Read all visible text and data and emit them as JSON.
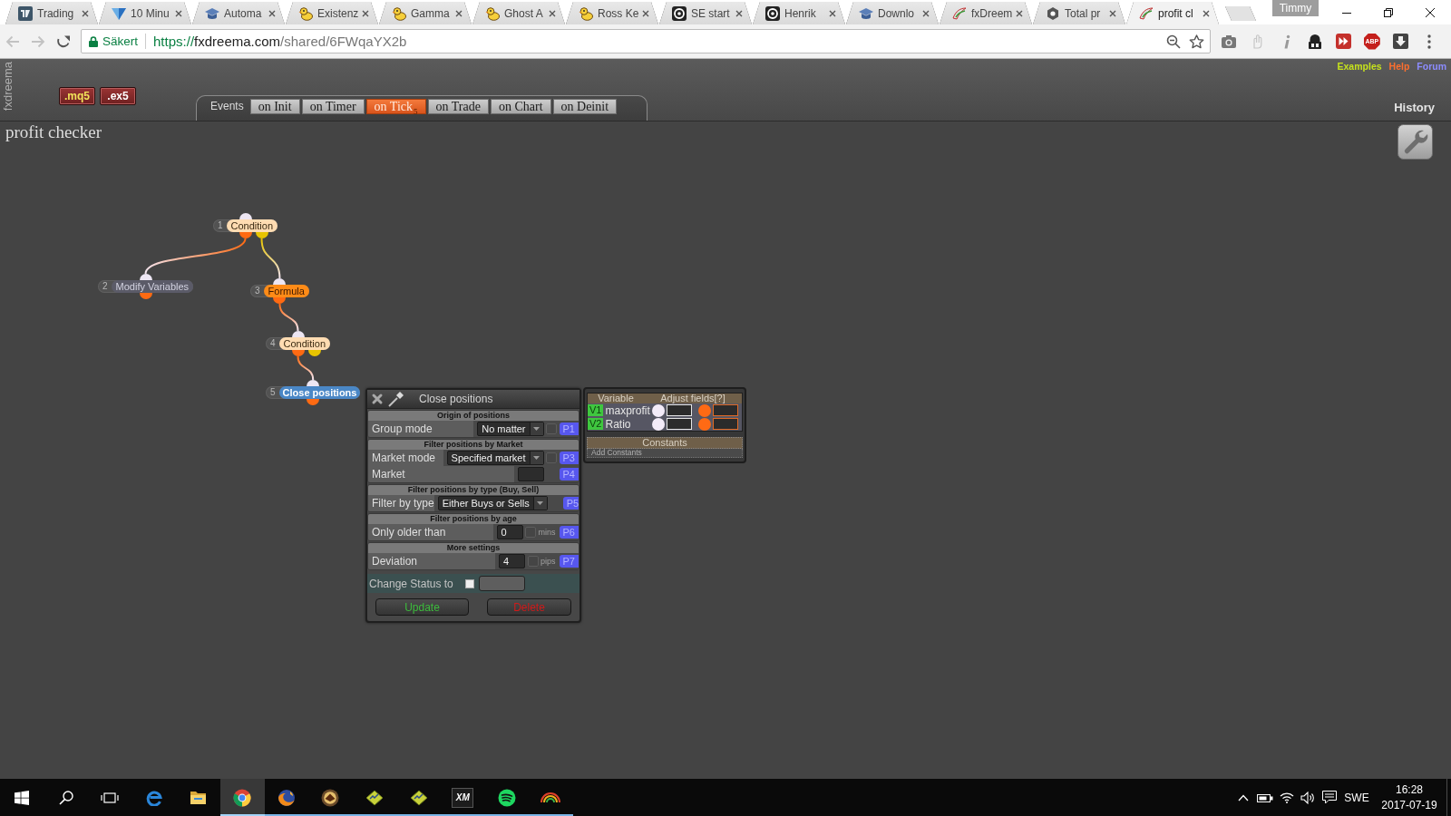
{
  "browser": {
    "tabs": [
      {
        "kind": "tile",
        "title": "Trading",
        "selected": false
      },
      {
        "kind": "triangle",
        "title": "10 Minu",
        "selected": false
      },
      {
        "kind": "cap",
        "title": "Automa",
        "selected": false
      },
      {
        "kind": "duck",
        "title": "Existenz",
        "selected": false
      },
      {
        "kind": "duck",
        "title": "Gamma",
        "selected": false
      },
      {
        "kind": "duck",
        "title": "Ghost A",
        "selected": false
      },
      {
        "kind": "duck",
        "title": "Ross Ke",
        "selected": false
      },
      {
        "kind": "disc",
        "title": "SE start",
        "selected": false
      },
      {
        "kind": "disc",
        "title": "Henrik",
        "selected": false
      },
      {
        "kind": "cap",
        "title": "Downlo",
        "selected": false
      },
      {
        "kind": "swoosh",
        "title": "fxDreem",
        "selected": false
      },
      {
        "kind": "hexagon",
        "title": "Total pr",
        "selected": false
      },
      {
        "kind": "swoosh",
        "title": "profit cl",
        "selected": true
      }
    ],
    "profile": "Timmy",
    "security_label": "Säkert",
    "url": "https://fxdreema.com/shared/6FWqaYX2b",
    "extensions": [
      {
        "kind": "camera"
      },
      {
        "kind": "pointer"
      },
      {
        "kind": "info"
      },
      {
        "kind": "figure"
      },
      {
        "kind": "forward"
      },
      {
        "kind": "octagon",
        "label": "ABP"
      },
      {
        "kind": "download"
      }
    ]
  },
  "app": {
    "side_label": "fxdreema",
    "export_buttons": [
      {
        "label": ".mq5",
        "kind": "source"
      },
      {
        "label": ".ex5",
        "kind": "compiled"
      }
    ],
    "events": {
      "label": "Events",
      "tabs": [
        {
          "label": "on Init",
          "selected": false
        },
        {
          "label": "on Timer",
          "selected": false
        },
        {
          "label": "on Tick",
          "selected": true,
          "count": "5"
        },
        {
          "label": "on Trade",
          "selected": false
        },
        {
          "label": "on Chart",
          "selected": false
        },
        {
          "label": "on Deinit",
          "selected": false
        }
      ]
    },
    "links": [
      {
        "label": "Examples",
        "color": "#c6e21c"
      },
      {
        "label": "Help",
        "color": "#ff6f2e"
      },
      {
        "label": "Forum",
        "color": "#8c8cff"
      }
    ],
    "history": "History",
    "project_title": "profit checker",
    "diagram": {
      "blocks": [
        {
          "number": "1",
          "label": "Condition",
          "kind": "condition",
          "selected": false,
          "children": [
            {
              "from_secondary": false,
              "number": "2",
              "label": "Modify Variables",
              "kind": "variables",
              "selected": false
            },
            {
              "from_secondary": true,
              "number": "3",
              "label": "Formula",
              "kind": "formula",
              "selected": false,
              "children": [
                {
                  "from_secondary": false,
                  "number": "4",
                  "label": "Condition",
                  "kind": "condition",
                  "selected": false,
                  "children": [
                    {
                      "from_secondary": false,
                      "number": "5",
                      "label": "Close positions",
                      "kind": "trade",
                      "selected": true
                    }
                  ]
                }
              ]
            }
          ]
        }
      ]
    },
    "block_panel": {
      "title": "Close positions",
      "sections": [
        {
          "heading": "Origin of positions",
          "rows": [
            {
              "kind": "select",
              "label": "Group mode",
              "value": "No matter",
              "checked": false,
              "param": "P1"
            }
          ]
        },
        {
          "heading": "Filter positions by Market",
          "rows": [
            {
              "kind": "select",
              "label": "Market mode",
              "value": "Specified market",
              "checked": false,
              "param": "P3"
            },
            {
              "kind": "input",
              "label": "Market",
              "param": "P4"
            }
          ]
        },
        {
          "heading": "Filter positions by type (Buy, Sell)",
          "rows": [
            {
              "kind": "select",
              "label": "Filter by type",
              "value": "Either Buys or Sells",
              "param": "P5"
            }
          ]
        },
        {
          "heading": "Filter positions by age",
          "rows": [
            {
              "kind": "input",
              "label": "Only older than",
              "value": "0",
              "checked": false,
              "unit": "mins",
              "param": "P6"
            }
          ]
        },
        {
          "heading": "More settings",
          "rows": [
            {
              "kind": "input",
              "label": "Deviation",
              "value": "4",
              "checked": false,
              "unit": "pips",
              "param": "P7"
            }
          ]
        }
      ],
      "status": {
        "label": "Change Status to",
        "checked": false
      },
      "buttons": [
        {
          "kind": "update",
          "label": "Update"
        },
        {
          "kind": "delete",
          "label": "Delete"
        }
      ]
    },
    "variables_panel": {
      "columns": [
        "Variable",
        "Adjust fields[?]"
      ],
      "variables": [
        {
          "id": "V1",
          "name": "maxprofit"
        },
        {
          "id": "V2",
          "name": "Ratio"
        }
      ],
      "constants_heading": "Constants",
      "add_label": "Add Constants"
    }
  },
  "taskbar": {
    "apps": [
      {
        "kind": "letter",
        "running": false,
        "selected": false
      },
      {
        "kind": "folder",
        "running": false,
        "selected": false
      },
      {
        "kind": "ring",
        "running": true,
        "selected": true
      },
      {
        "kind": "fox",
        "running": true,
        "selected": false
      },
      {
        "kind": "emblem",
        "running": true,
        "selected": false
      },
      {
        "kind": "diamond",
        "running": true,
        "selected": false
      },
      {
        "kind": "diamond",
        "running": true,
        "selected": false
      },
      {
        "kind": "tile",
        "label": "XM",
        "running": true,
        "selected": false
      },
      {
        "kind": "waves",
        "running": true,
        "selected": false
      },
      {
        "kind": "arcs",
        "running": true,
        "selected": false
      }
    ],
    "language": "SWE",
    "time": "16:28",
    "date": "2017-07-19"
  }
}
